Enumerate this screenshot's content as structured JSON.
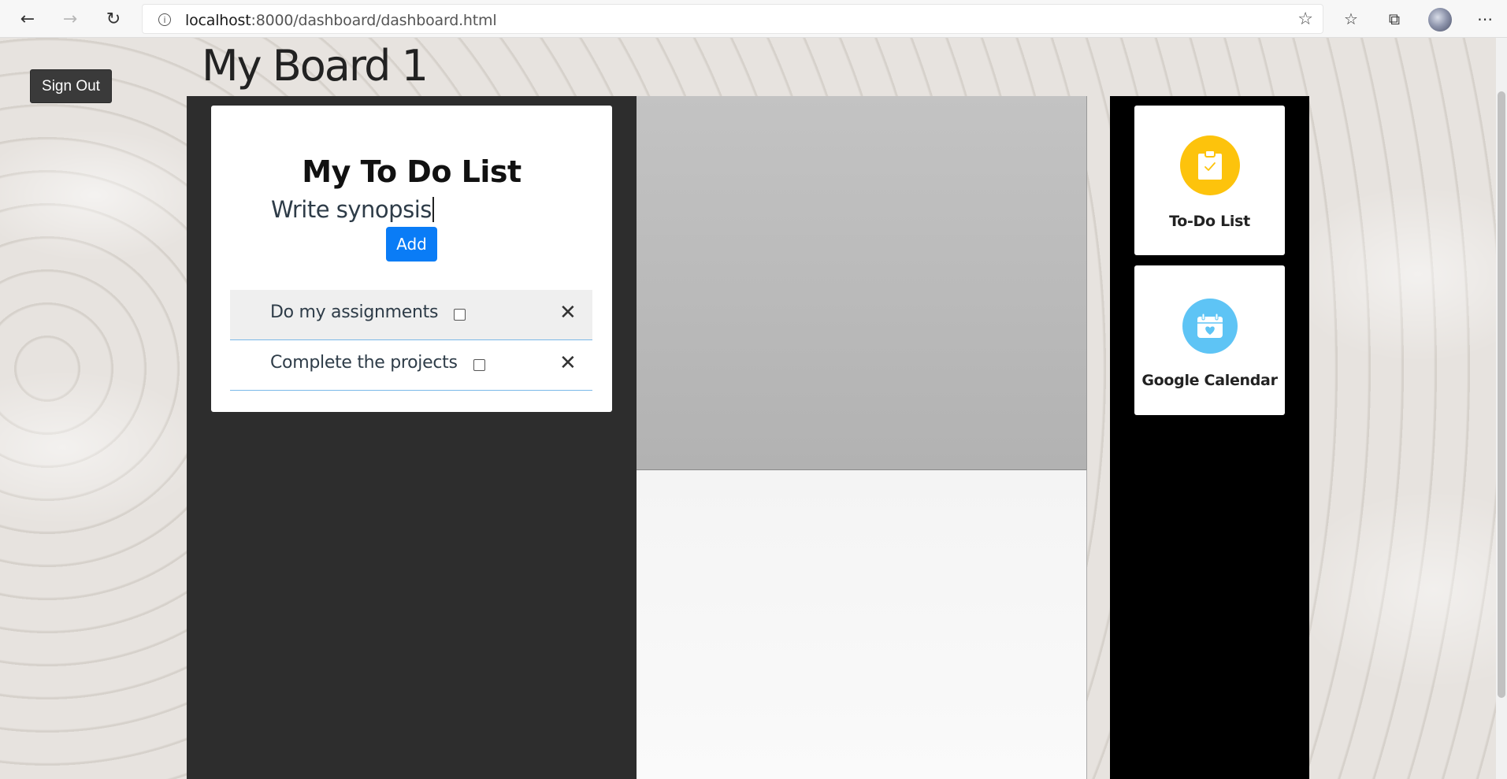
{
  "browser": {
    "url_host": "localhost",
    "url_rest": ":8000/dashboard/dashboard.html"
  },
  "page": {
    "sign_out_label": "Sign Out",
    "board_title": "My Board 1"
  },
  "todo": {
    "title": "My To Do List",
    "input_value": "Write synopsis",
    "add_label": "Add",
    "items": [
      {
        "label": "Do my assignments",
        "checked": false
      },
      {
        "label": "Complete the projects",
        "checked": false
      }
    ],
    "delete_glyph": "✕"
  },
  "widgets": [
    {
      "label": "To-Do List",
      "icon": "clipboard-check-icon",
      "color": "#fdc30c"
    },
    {
      "label": "Google Calendar",
      "icon": "calendar-heart-icon",
      "color": "#5ec4f5"
    }
  ],
  "colors": {
    "add_button": "#0a7cf6",
    "sign_out_button": "#3a3a3a",
    "item_divider": "#7ab8e8"
  }
}
